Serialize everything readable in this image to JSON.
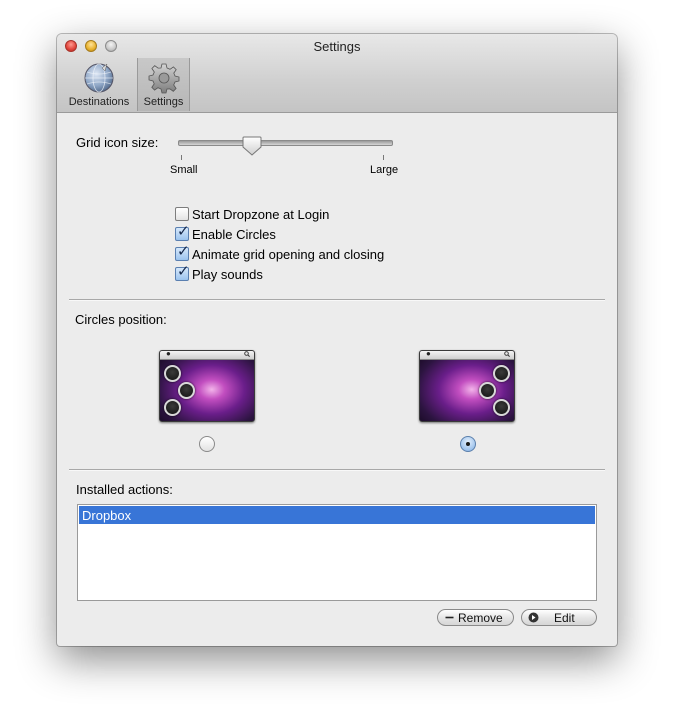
{
  "window": {
    "title": "Settings"
  },
  "toolbar": {
    "items": [
      {
        "label": "Destinations",
        "icon": "globe-icon"
      },
      {
        "label": "Settings",
        "icon": "gear-icon",
        "selected": true
      }
    ]
  },
  "grid_size": {
    "label": "Grid icon size:",
    "min_label": "Small",
    "max_label": "Large",
    "value_fraction": 0.33
  },
  "options": [
    {
      "label": "Start Dropzone at Login",
      "checked": false
    },
    {
      "label": "Enable Circles",
      "checked": true
    },
    {
      "label": "Animate grid opening and closing",
      "checked": true
    },
    {
      "label": "Play sounds",
      "checked": true
    }
  ],
  "circles_position": {
    "label": "Circles position:",
    "choices": [
      {
        "side": "left",
        "selected": false
      },
      {
        "side": "right",
        "selected": true
      }
    ]
  },
  "installed_actions": {
    "label": "Installed actions:",
    "items": [
      {
        "label": "Dropbox",
        "selected": true
      }
    ]
  },
  "buttons": {
    "remove": "Remove",
    "edit": "Edit"
  },
  "colors": {
    "selection": "#3875d7",
    "window_bg": "#ececec"
  }
}
